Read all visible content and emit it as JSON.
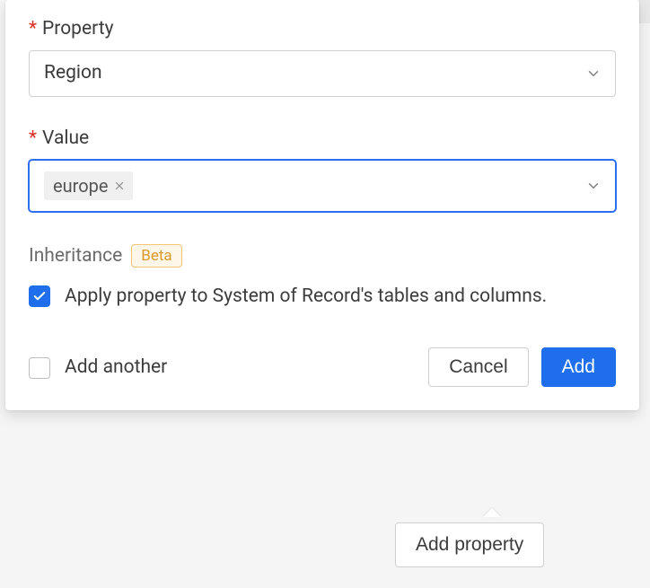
{
  "form": {
    "property": {
      "label": "Property",
      "value": "Region"
    },
    "value": {
      "label": "Value",
      "chip": "europe"
    },
    "inheritance": {
      "label": "Inheritance",
      "badge": "Beta",
      "checkbox_text": "Apply property to System of Record's tables and columns.",
      "checked": true
    },
    "footer": {
      "add_another_label": "Add another",
      "add_another_checked": false,
      "cancel": "Cancel",
      "add": "Add"
    }
  },
  "background": {
    "add_property_button": "Add property"
  }
}
